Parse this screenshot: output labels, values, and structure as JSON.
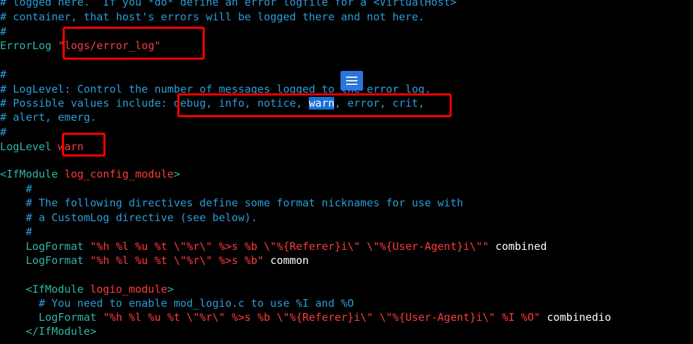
{
  "editor": {
    "lines": {
      "l0": {
        "text": "# logged here.  If you *do* define an error logfile for a <VirtualHost>"
      },
      "l1": {
        "text": "# container, that host's errors will be logged there and not here."
      },
      "l2": {
        "text": "#"
      },
      "l3": {
        "directive": "ErrorLog",
        "value": "\"logs/error_log\""
      },
      "l4": {
        "text": ""
      },
      "l5": {
        "text": "#"
      },
      "l6": {
        "text": "# LogLevel: Control the number of messages logged to the error log."
      },
      "l7": {
        "prefix": "# Possible values include: debug, info, notice, ",
        "highlight": "warn",
        "suffix": ", error, crit,"
      },
      "l8": {
        "text": "# alert, emerg."
      },
      "l9": {
        "text": "#"
      },
      "l10": {
        "directive": "LogLevel",
        "value": "warn"
      },
      "l11": {
        "text": ""
      },
      "l12": {
        "open": "<IfModule ",
        "module": "log_config_module",
        "close": ">"
      },
      "l13": {
        "text": "    #"
      },
      "l14": {
        "text": "    # The following directives define some format nicknames for use with"
      },
      "l15": {
        "text": "    # a CustomLog directive (see below)."
      },
      "l16": {
        "text": "    #"
      },
      "l17": {
        "directive": "    LogFormat",
        "value": "\"%h %l %u %t \\\"%r\\\" %>s %b \\\"%{Referer}i\\\" \\\"%{User-Agent}i\\\"\"",
        "nickname": "combined"
      },
      "l18": {
        "directive": "    LogFormat",
        "value": "\"%h %l %u %t \\\"%r\\\" %>s %b\"",
        "nickname": "common"
      },
      "l19": {
        "text": ""
      },
      "l20": {
        "open": "    <IfModule ",
        "module": "logio_module",
        "close": ">"
      },
      "l21": {
        "text": "      # You need to enable mod_logio.c to use %I and %O"
      },
      "l22": {
        "directive": "      LogFormat",
        "value": "\"%h %l %u %t \\\"%r\\\" %>s %b \\\"%{Referer}i\\\" \\\"%{User-Agent}i\\\" %I %O\"",
        "nickname": "combinedio"
      },
      "l23": {
        "text": "    </IfModule>"
      }
    }
  },
  "colors": {
    "comment": "#2a9dd8",
    "directive": "#2fb5a6",
    "value": "#ff3b3b",
    "highlight": "#1a6fd9",
    "annotation_box": "#ff0000"
  },
  "overlay": {
    "icon": "menu-lines-icon"
  }
}
